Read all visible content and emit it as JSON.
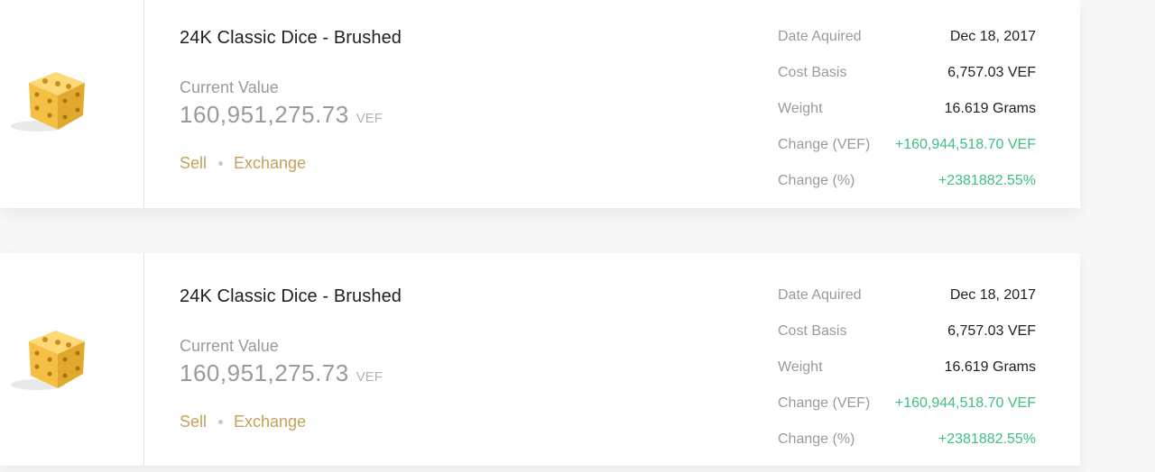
{
  "holdings": [
    {
      "title": "24K Classic Dice - Brushed",
      "current_value_label": "Current Value",
      "current_value": "160,951,275.73",
      "currency": "VEF",
      "actions": {
        "sell": "Sell",
        "exchange": "Exchange"
      },
      "details": [
        {
          "label": "Date Aquired",
          "value": "Dec 18, 2017",
          "positive": false
        },
        {
          "label": "Cost Basis",
          "value": "6,757.03 VEF",
          "positive": false
        },
        {
          "label": "Weight",
          "value": "16.619 Grams",
          "positive": false
        },
        {
          "label": "Change (VEF)",
          "value": "+160,944,518.70 VEF",
          "positive": true
        },
        {
          "label": "Change (%)",
          "value": "+2381882.55%",
          "positive": true
        }
      ]
    },
    {
      "title": "24K Classic Dice - Brushed",
      "current_value_label": "Current Value",
      "current_value": "160,951,275.73",
      "currency": "VEF",
      "actions": {
        "sell": "Sell",
        "exchange": "Exchange"
      },
      "details": [
        {
          "label": "Date Aquired",
          "value": "Dec 18, 2017",
          "positive": false
        },
        {
          "label": "Cost Basis",
          "value": "6,757.03 VEF",
          "positive": false
        },
        {
          "label": "Weight",
          "value": "16.619 Grams",
          "positive": false
        },
        {
          "label": "Change (VEF)",
          "value": "+160,944,518.70 VEF",
          "positive": true
        },
        {
          "label": "Change (%)",
          "value": "+2381882.55%",
          "positive": true
        }
      ]
    }
  ],
  "colors": {
    "accent_gold": "#c2a15a",
    "positive_green": "#3fbf82",
    "muted_text": "#9a9a9a",
    "dice_gold": "#f2c14e"
  }
}
